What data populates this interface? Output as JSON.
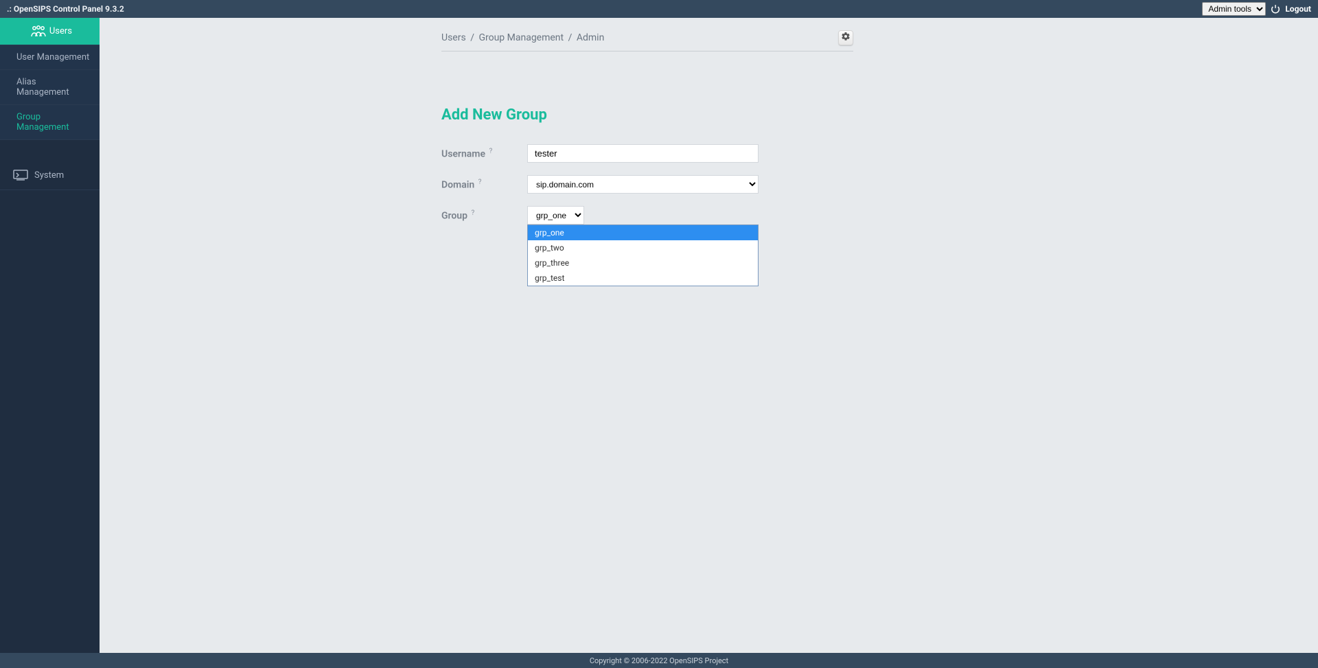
{
  "header": {
    "title": ".: OpenSIPS Control Panel 9.3.2",
    "admin_tools": "Admin tools",
    "logout": "Logout"
  },
  "sidebar": {
    "users": "Users",
    "user_mgmt": "User Management",
    "alias_mgmt": "Alias Management",
    "group_mgmt": "Group Management",
    "system": "System"
  },
  "breadcrumb": {
    "a": "Users",
    "b": "Group Management",
    "c": "Admin"
  },
  "page": {
    "title": "Add New Group"
  },
  "form": {
    "username_label": "Username",
    "username_value": "tester",
    "domain_label": "Domain",
    "domain_value": "sip.domain.com",
    "group_label": "Group",
    "group_value": "grp_one",
    "group_options": {
      "0": "grp_one",
      "1": "grp_two",
      "2": "grp_three",
      "3": "grp_test"
    },
    "help": "?"
  },
  "footer": {
    "text": "Copyright © 2006-2022 OpenSIPS Project"
  }
}
